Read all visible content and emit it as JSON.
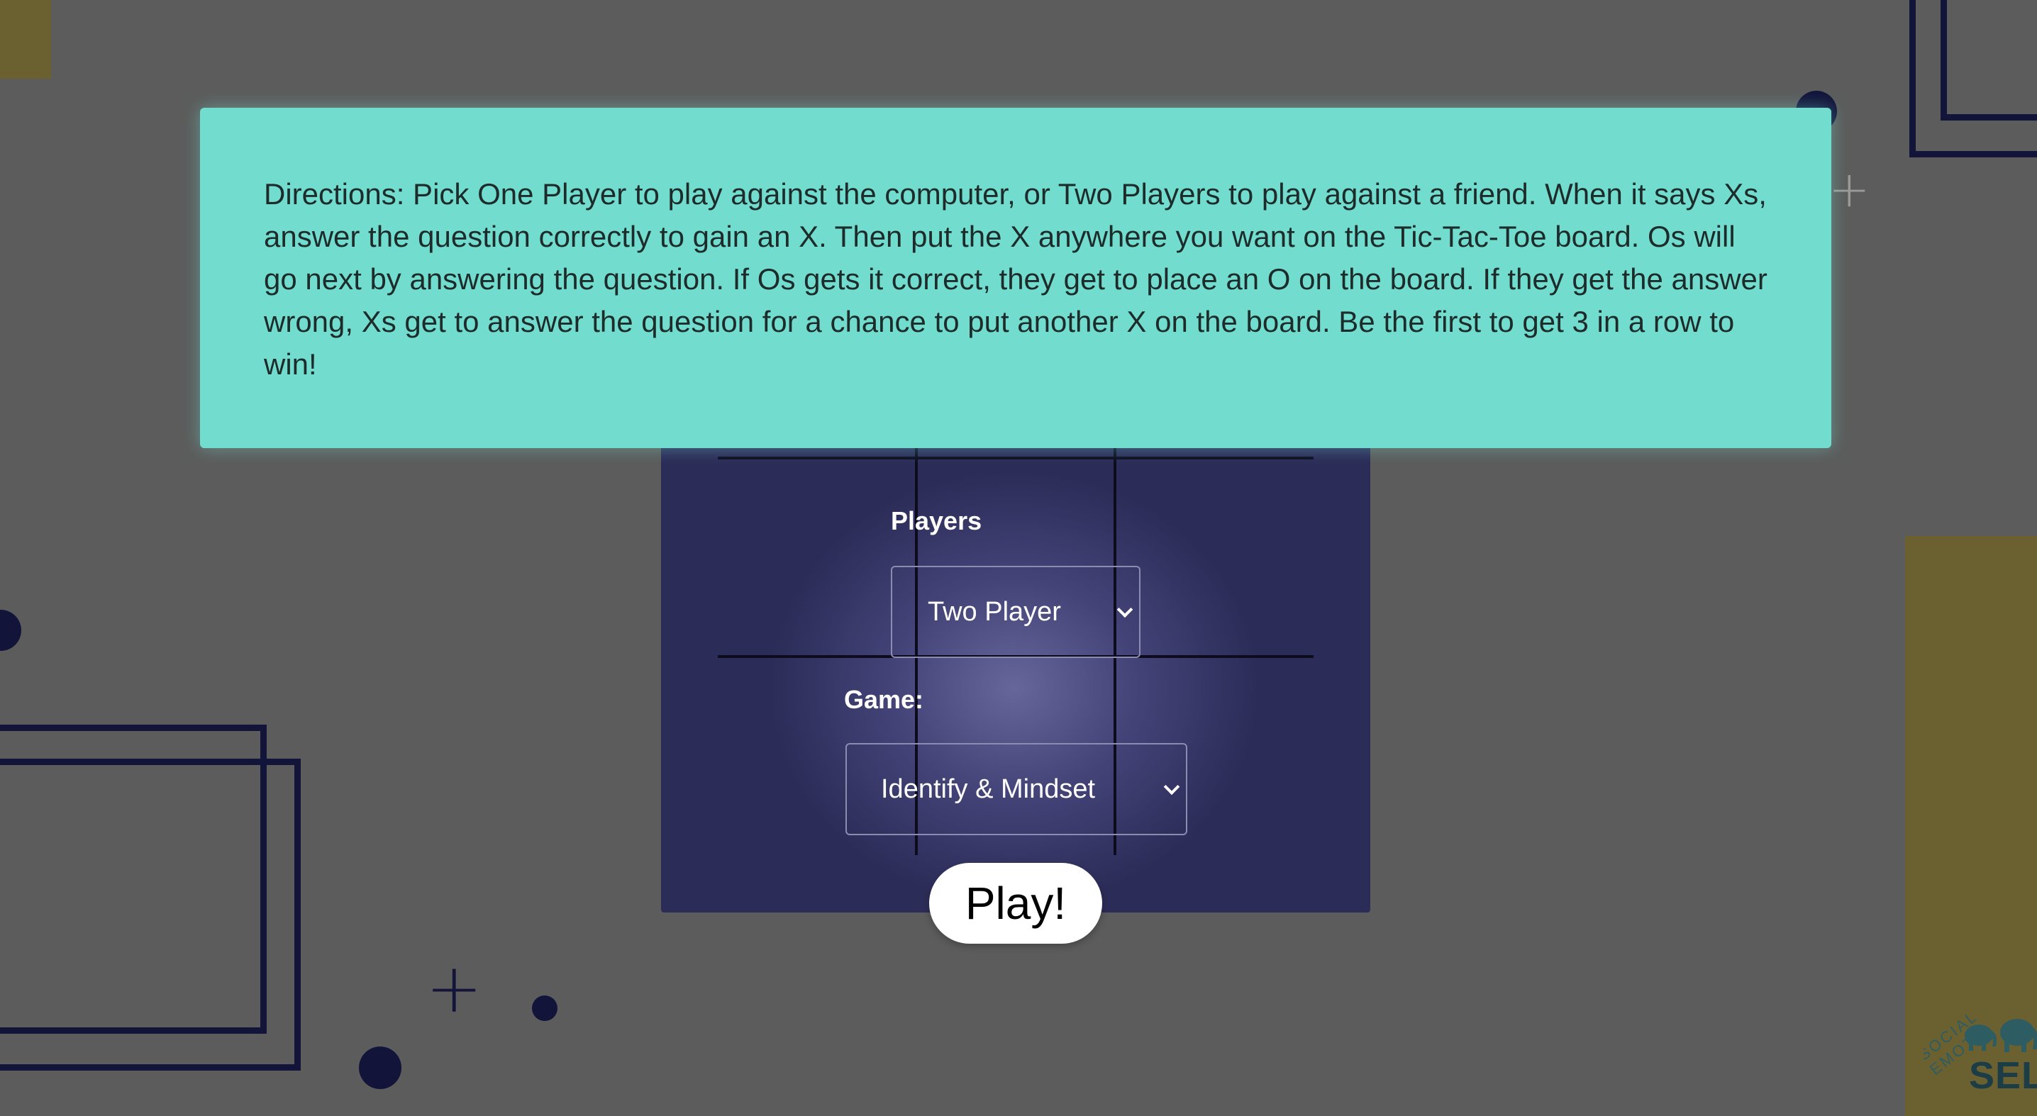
{
  "directions": {
    "text": "Directions: Pick One Player to play against the computer, or Two Players to play against a friend. When it says Xs, answer the question correctly to gain an X. Then put the X anywhere you want on the Tic-Tac-Toe board. Os will go next by answering the question. If Os gets it correct, they get to place an O on the board. If they get the answer wrong, Xs get to answer the question for a chance to put another X on the board. Be the first to get 3 in a row to win!"
  },
  "setup": {
    "players_label": "Players",
    "players_value": "Two Player",
    "game_label": "Game:",
    "game_value": "Identify & Mindset",
    "play_label": "Play!"
  },
  "logo": {
    "arc_text": "SOCIAL EMOT",
    "brand_text": "SELT"
  },
  "icons": {
    "select_chevron": "chevron-down-icon"
  },
  "colors": {
    "background": "#5c5c5c",
    "panel": "#2c2c58",
    "banner": "#72ddcf",
    "accent_yellow": "#6b6130",
    "decor_navy": "#13143a"
  }
}
